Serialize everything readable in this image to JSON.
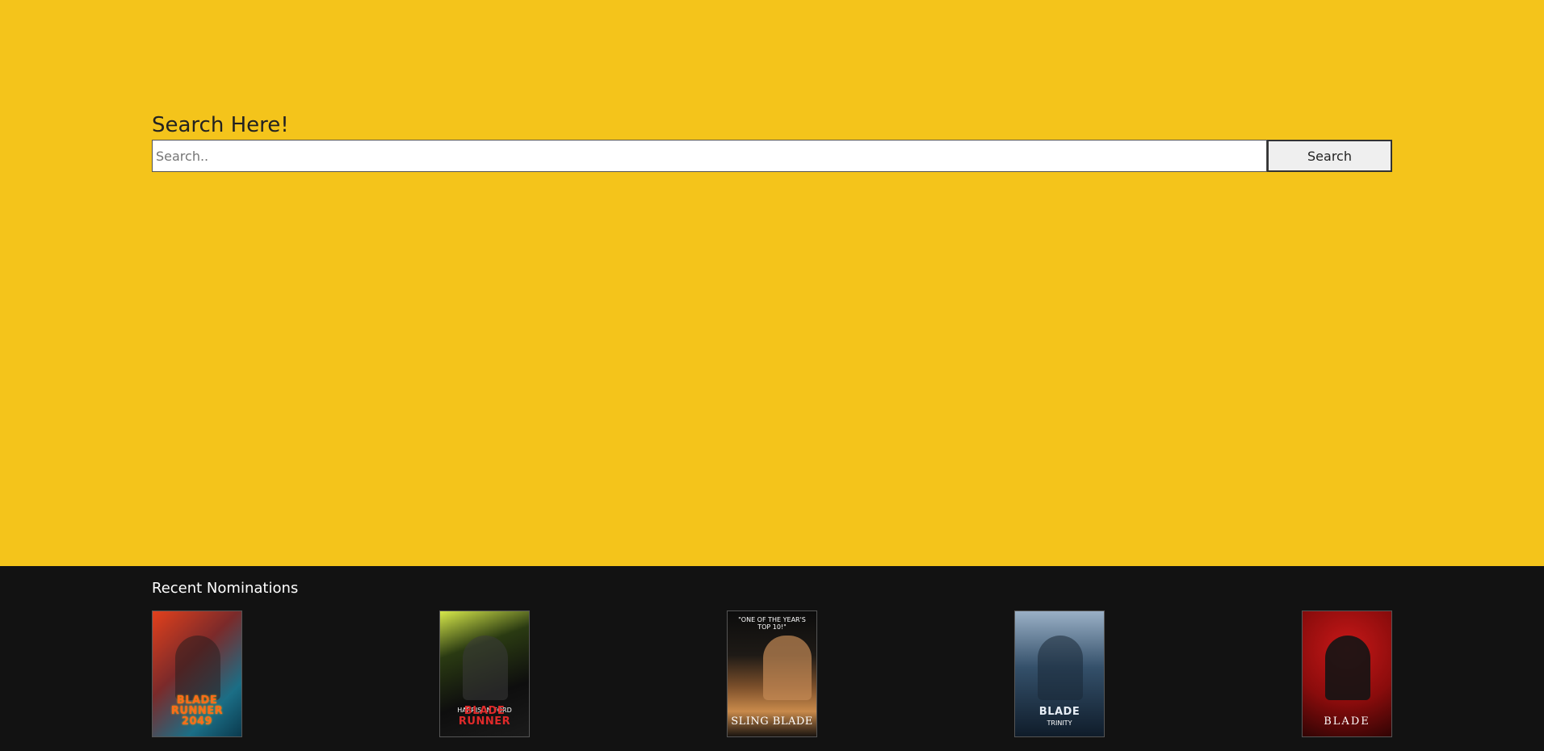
{
  "search": {
    "title": "Search Here!",
    "placeholder": "Search..",
    "value": "",
    "button_label": "Search"
  },
  "nominations": {
    "title": "Recent Nominations",
    "posters": [
      {
        "name": "poster-blade-runner-2049",
        "title": "BLADE RUNNER 2049",
        "tagline": ""
      },
      {
        "name": "poster-blade-runner",
        "title": "BLADE RUNNER",
        "tagline": "HARRISON FORD"
      },
      {
        "name": "poster-sling-blade",
        "title": "SLING BLADE",
        "tagline": "\"ONE OF THE YEAR'S TOP 10!\""
      },
      {
        "name": "poster-blade-trinity",
        "title": "BLADE",
        "tagline": "TRINITY"
      },
      {
        "name": "poster-blade",
        "title": "BLADE",
        "tagline": ""
      }
    ]
  },
  "colors": {
    "top_background": "#f4c41b",
    "bottom_background": "#121212"
  }
}
